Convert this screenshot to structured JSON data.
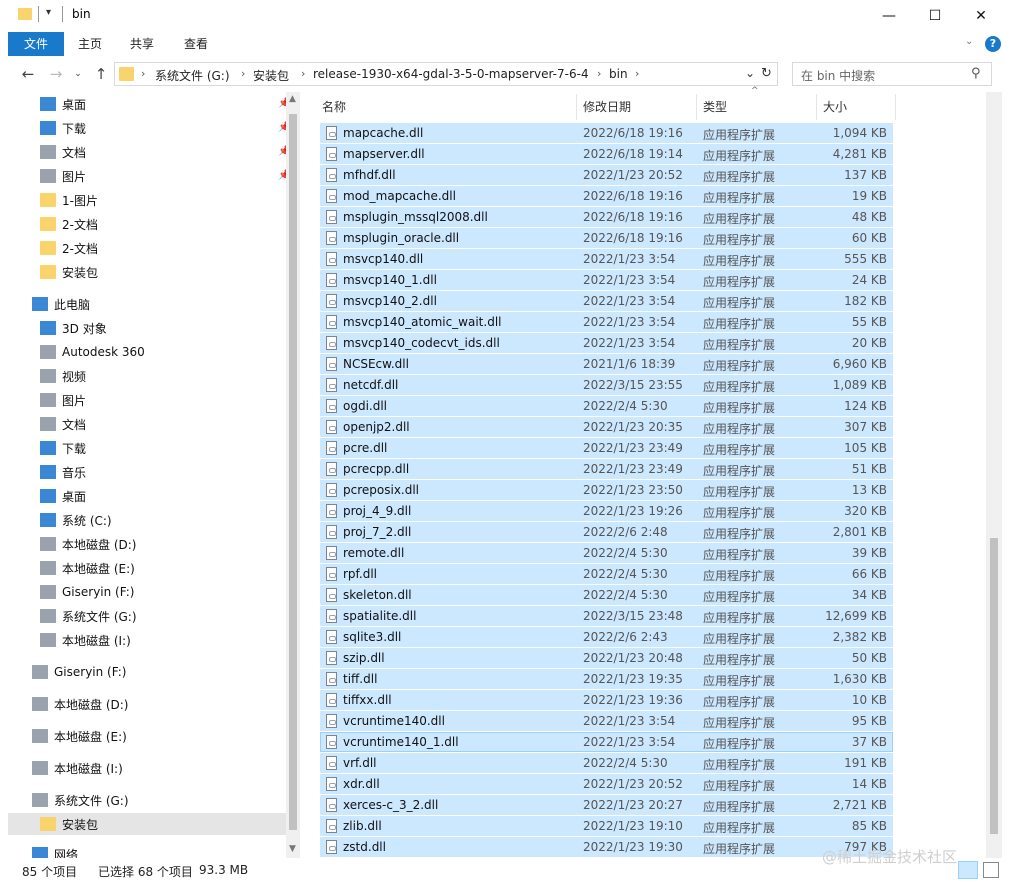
{
  "window": {
    "title": "bin",
    "minimize_glyph": "—",
    "maximize_glyph": "☐",
    "close_glyph": "✕"
  },
  "ribbon": {
    "tabs": [
      "文件",
      "主页",
      "共享",
      "查看"
    ]
  },
  "address": {
    "segments": [
      "系统文件 (G:)",
      "安装包",
      "release-1930-x64-gdal-3-5-0-mapserver-7-6-4",
      "bin"
    ],
    "search_placeholder": "在 bin 中搜索"
  },
  "sidebar": {
    "quick_access": [
      {
        "label": "桌面",
        "icon": "desktop-icon",
        "pinned": true
      },
      {
        "label": "下载",
        "icon": "download-icon",
        "pinned": true
      },
      {
        "label": "文档",
        "icon": "document-icon",
        "pinned": true
      },
      {
        "label": "图片",
        "icon": "pictures-icon",
        "pinned": true
      },
      {
        "label": "1-图片",
        "icon": "folder-icon",
        "pinned": false
      },
      {
        "label": "2-文档",
        "icon": "folder-icon",
        "pinned": false
      },
      {
        "label": "2-文档",
        "icon": "folder-icon",
        "pinned": false
      },
      {
        "label": "安装包",
        "icon": "folder-icon",
        "pinned": false
      }
    ],
    "this_pc_label": "此电脑",
    "this_pc": [
      {
        "label": "3D 对象",
        "icon": "3d-objects-icon"
      },
      {
        "label": "Autodesk 360",
        "icon": "cloud-icon"
      },
      {
        "label": "视频",
        "icon": "video-icon"
      },
      {
        "label": "图片",
        "icon": "pictures-icon"
      },
      {
        "label": "文档",
        "icon": "document-icon"
      },
      {
        "label": "下载",
        "icon": "download-icon"
      },
      {
        "label": "音乐",
        "icon": "music-icon"
      },
      {
        "label": "桌面",
        "icon": "desktop-icon"
      },
      {
        "label": "系统 (C:)",
        "icon": "windows-drive-icon"
      },
      {
        "label": "本地磁盘 (D:)",
        "icon": "drive-icon"
      },
      {
        "label": "本地磁盘 (E:)",
        "icon": "drive-icon"
      },
      {
        "label": "Giseryin (F:)",
        "icon": "drive-icon"
      },
      {
        "label": "系统文件 (G:)",
        "icon": "drive-icon"
      },
      {
        "label": "本地磁盘 (I:)",
        "icon": "drive-icon"
      }
    ],
    "drives": [
      {
        "label": "Giseryin (F:)",
        "icon": "drive-icon"
      },
      {
        "label": "本地磁盘 (D:)",
        "icon": "drive-icon"
      },
      {
        "label": "本地磁盘 (E:)",
        "icon": "drive-icon"
      },
      {
        "label": "本地磁盘 (I:)",
        "icon": "drive-icon"
      },
      {
        "label": "系统文件 (G:)",
        "icon": "drive-icon"
      },
      {
        "label": "安装包",
        "icon": "folder-icon",
        "selected": true
      }
    ],
    "network_label": "网络"
  },
  "columns": {
    "name": "名称",
    "date": "修改日期",
    "type": "类型",
    "size": "大小"
  },
  "files": [
    {
      "name": "mapcache.dll",
      "date": "2022/6/18 19:16",
      "type": "应用程序扩展",
      "size": "1,094 KB"
    },
    {
      "name": "mapserver.dll",
      "date": "2022/6/18 19:14",
      "type": "应用程序扩展",
      "size": "4,281 KB"
    },
    {
      "name": "mfhdf.dll",
      "date": "2022/1/23 20:52",
      "type": "应用程序扩展",
      "size": "137 KB"
    },
    {
      "name": "mod_mapcache.dll",
      "date": "2022/6/18 19:16",
      "type": "应用程序扩展",
      "size": "19 KB"
    },
    {
      "name": "msplugin_mssql2008.dll",
      "date": "2022/6/18 19:16",
      "type": "应用程序扩展",
      "size": "48 KB"
    },
    {
      "name": "msplugin_oracle.dll",
      "date": "2022/6/18 19:16",
      "type": "应用程序扩展",
      "size": "60 KB"
    },
    {
      "name": "msvcp140.dll",
      "date": "2022/1/23 3:54",
      "type": "应用程序扩展",
      "size": "555 KB"
    },
    {
      "name": "msvcp140_1.dll",
      "date": "2022/1/23 3:54",
      "type": "应用程序扩展",
      "size": "24 KB"
    },
    {
      "name": "msvcp140_2.dll",
      "date": "2022/1/23 3:54",
      "type": "应用程序扩展",
      "size": "182 KB"
    },
    {
      "name": "msvcp140_atomic_wait.dll",
      "date": "2022/1/23 3:54",
      "type": "应用程序扩展",
      "size": "55 KB"
    },
    {
      "name": "msvcp140_codecvt_ids.dll",
      "date": "2022/1/23 3:54",
      "type": "应用程序扩展",
      "size": "20 KB"
    },
    {
      "name": "NCSEcw.dll",
      "date": "2021/1/6 18:39",
      "type": "应用程序扩展",
      "size": "6,960 KB"
    },
    {
      "name": "netcdf.dll",
      "date": "2022/3/15 23:55",
      "type": "应用程序扩展",
      "size": "1,089 KB"
    },
    {
      "name": "ogdi.dll",
      "date": "2022/2/4 5:30",
      "type": "应用程序扩展",
      "size": "124 KB"
    },
    {
      "name": "openjp2.dll",
      "date": "2022/1/23 20:35",
      "type": "应用程序扩展",
      "size": "307 KB"
    },
    {
      "name": "pcre.dll",
      "date": "2022/1/23 23:49",
      "type": "应用程序扩展",
      "size": "105 KB"
    },
    {
      "name": "pcrecpp.dll",
      "date": "2022/1/23 23:49",
      "type": "应用程序扩展",
      "size": "51 KB"
    },
    {
      "name": "pcreposix.dll",
      "date": "2022/1/23 23:50",
      "type": "应用程序扩展",
      "size": "13 KB"
    },
    {
      "name": "proj_4_9.dll",
      "date": "2022/1/23 19:26",
      "type": "应用程序扩展",
      "size": "320 KB"
    },
    {
      "name": "proj_7_2.dll",
      "date": "2022/2/6 2:48",
      "type": "应用程序扩展",
      "size": "2,801 KB"
    },
    {
      "name": "remote.dll",
      "date": "2022/2/4 5:30",
      "type": "应用程序扩展",
      "size": "39 KB"
    },
    {
      "name": "rpf.dll",
      "date": "2022/2/4 5:30",
      "type": "应用程序扩展",
      "size": "66 KB"
    },
    {
      "name": "skeleton.dll",
      "date": "2022/2/4 5:30",
      "type": "应用程序扩展",
      "size": "34 KB"
    },
    {
      "name": "spatialite.dll",
      "date": "2022/3/15 23:48",
      "type": "应用程序扩展",
      "size": "12,699 KB"
    },
    {
      "name": "sqlite3.dll",
      "date": "2022/2/6 2:43",
      "type": "应用程序扩展",
      "size": "2,382 KB"
    },
    {
      "name": "szip.dll",
      "date": "2022/1/23 20:48",
      "type": "应用程序扩展",
      "size": "50 KB"
    },
    {
      "name": "tiff.dll",
      "date": "2022/1/23 19:35",
      "type": "应用程序扩展",
      "size": "1,630 KB"
    },
    {
      "name": "tiffxx.dll",
      "date": "2022/1/23 19:36",
      "type": "应用程序扩展",
      "size": "10 KB"
    },
    {
      "name": "vcruntime140.dll",
      "date": "2022/1/23 3:54",
      "type": "应用程序扩展",
      "size": "95 KB"
    },
    {
      "name": "vcruntime140_1.dll",
      "date": "2022/1/23 3:54",
      "type": "应用程序扩展",
      "size": "37 KB",
      "focused": true
    },
    {
      "name": "vrf.dll",
      "date": "2022/2/4 5:30",
      "type": "应用程序扩展",
      "size": "191 KB"
    },
    {
      "name": "xdr.dll",
      "date": "2022/1/23 20:52",
      "type": "应用程序扩展",
      "size": "14 KB"
    },
    {
      "name": "xerces-c_3_2.dll",
      "date": "2022/1/23 20:27",
      "type": "应用程序扩展",
      "size": "2,721 KB"
    },
    {
      "name": "zlib.dll",
      "date": "2022/1/23 19:10",
      "type": "应用程序扩展",
      "size": "85 KB"
    },
    {
      "name": "zstd.dll",
      "date": "2022/1/23 19:30",
      "type": "应用程序扩展",
      "size": "797 KB"
    }
  ],
  "status": {
    "count": "85 个项目",
    "selection": "已选择 68 个项目",
    "size": "93.3 MB"
  },
  "watermark": "@稀土掘金技术社区",
  "colors": {
    "accent": "#1979ca",
    "selection": "#cce8ff",
    "selection_border": "#99d1ff",
    "folder": "#f9d36b"
  }
}
